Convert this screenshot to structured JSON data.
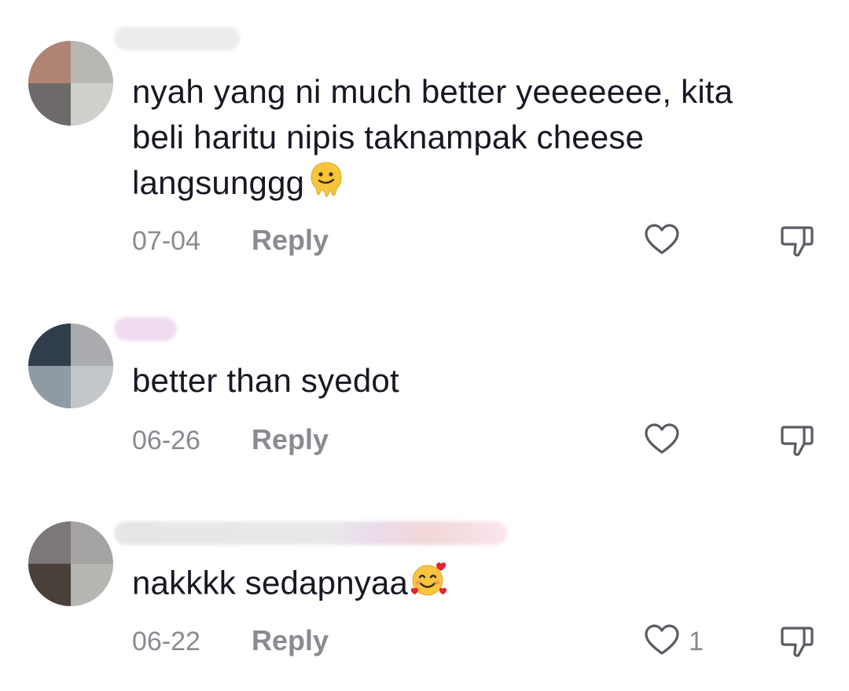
{
  "comments": [
    {
      "text_lines": [
        "nyah yang ni much better yeeeeeee, kita",
        "beli haritu nipis taknampak cheese",
        "langsunggg"
      ],
      "emoji": "melting-face",
      "date": "07-04",
      "reply_label": "Reply",
      "like_count": ""
    },
    {
      "text_lines": [
        "better than syedot"
      ],
      "emoji": "",
      "date": "06-26",
      "reply_label": "Reply",
      "like_count": ""
    },
    {
      "text_lines": [
        "nakkkk sedapnyaa"
      ],
      "emoji": "smiling-face-with-hearts",
      "date": "06-22",
      "reply_label": "Reply",
      "like_count": "1"
    }
  ],
  "colors": {
    "text": "#161823",
    "secondary": "#8a8b91",
    "icon_stroke": "#5a5b63"
  }
}
